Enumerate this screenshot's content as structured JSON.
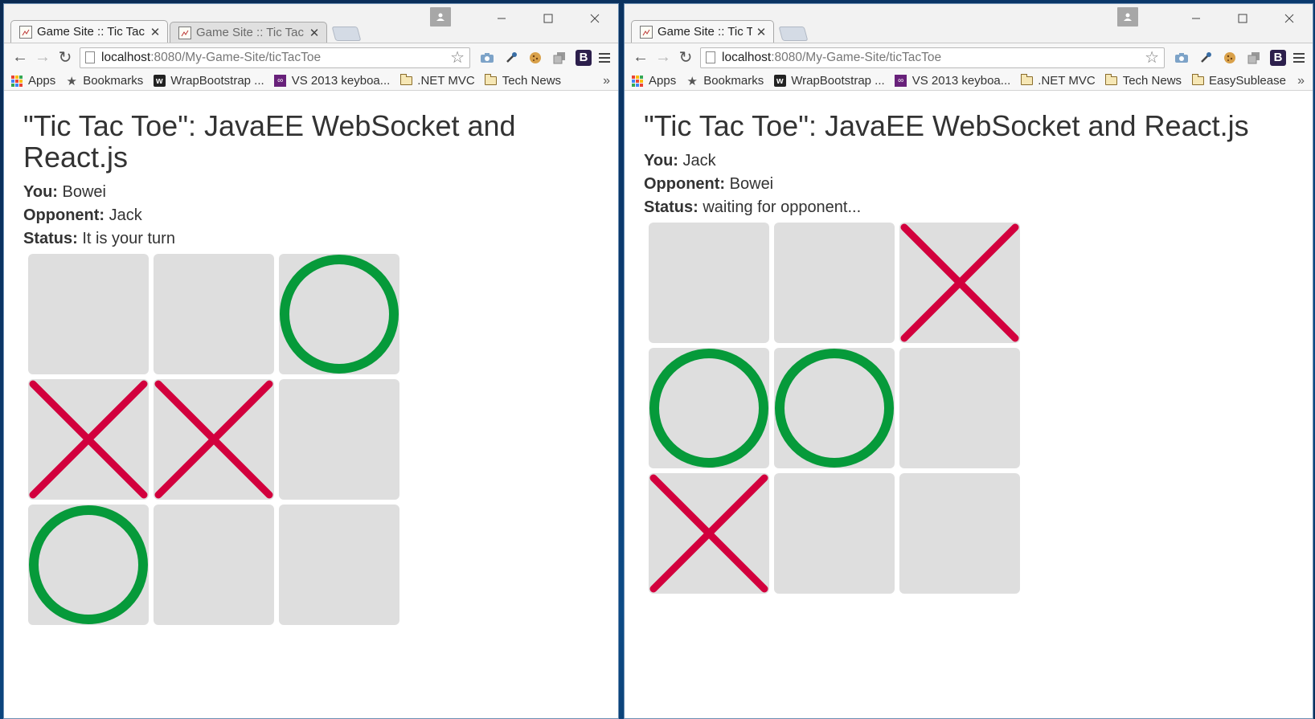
{
  "windows": [
    {
      "id": "left",
      "tabs": [
        {
          "title": "Game Site :: Tic Tac To",
          "active": true
        },
        {
          "title": "Game Site :: Tic Tac To",
          "active": false
        }
      ],
      "url": {
        "host": "localhost",
        "rest": ":8080/My-Game-Site/ticTacToe"
      },
      "bookmarks": [
        {
          "label": "Apps",
          "icon": "apps-icon"
        },
        {
          "label": "Bookmarks",
          "icon": "star-icon"
        },
        {
          "label": "WrapBootstrap ...",
          "icon": "wrapbootstrap-icon"
        },
        {
          "label": "VS 2013 keyboa...",
          "icon": "visual-studio-icon"
        },
        {
          "label": ".NET MVC",
          "icon": "folder-icon"
        },
        {
          "label": "Tech News",
          "icon": "folder-icon"
        }
      ],
      "more": "»",
      "page": {
        "title": "\"Tic Tac Toe\": JavaEE WebSocket and React.js",
        "you_label": "You:",
        "you": "Bowei",
        "opponent_label": "Opponent:",
        "opponent": "Jack",
        "status_label": "Status:",
        "status": "It is your turn"
      },
      "board": [
        "",
        "",
        "O",
        "X",
        "X",
        "",
        "O",
        "",
        ""
      ]
    },
    {
      "id": "right",
      "tabs": [
        {
          "title": "Game Site :: Tic Tac To",
          "active": true
        }
      ],
      "url": {
        "host": "localhost",
        "rest": ":8080/My-Game-Site/ticTacToe"
      },
      "bookmarks": [
        {
          "label": "Apps",
          "icon": "apps-icon"
        },
        {
          "label": "Bookmarks",
          "icon": "star-icon"
        },
        {
          "label": "WrapBootstrap ...",
          "icon": "wrapbootstrap-icon"
        },
        {
          "label": "VS 2013 keyboa...",
          "icon": "visual-studio-icon"
        },
        {
          "label": ".NET MVC",
          "icon": "folder-icon"
        },
        {
          "label": "Tech News",
          "icon": "folder-icon"
        },
        {
          "label": "EasySublease",
          "icon": "folder-icon"
        }
      ],
      "more": "»",
      "page": {
        "title": "\"Tic Tac Toe\": JavaEE WebSocket and React.js",
        "you_label": "You:",
        "you": "Jack",
        "opponent_label": "Opponent:",
        "opponent": "Bowei",
        "status_label": "Status:",
        "status": "waiting for opponent..."
      },
      "board": [
        "",
        "",
        "X",
        "O",
        "O",
        "",
        "X",
        "",
        ""
      ]
    }
  ],
  "colors": {
    "x_mark": "#d2003d",
    "o_mark": "#069a3a",
    "cell_bg": "#dedede",
    "desktop": "#0b3a6e"
  }
}
